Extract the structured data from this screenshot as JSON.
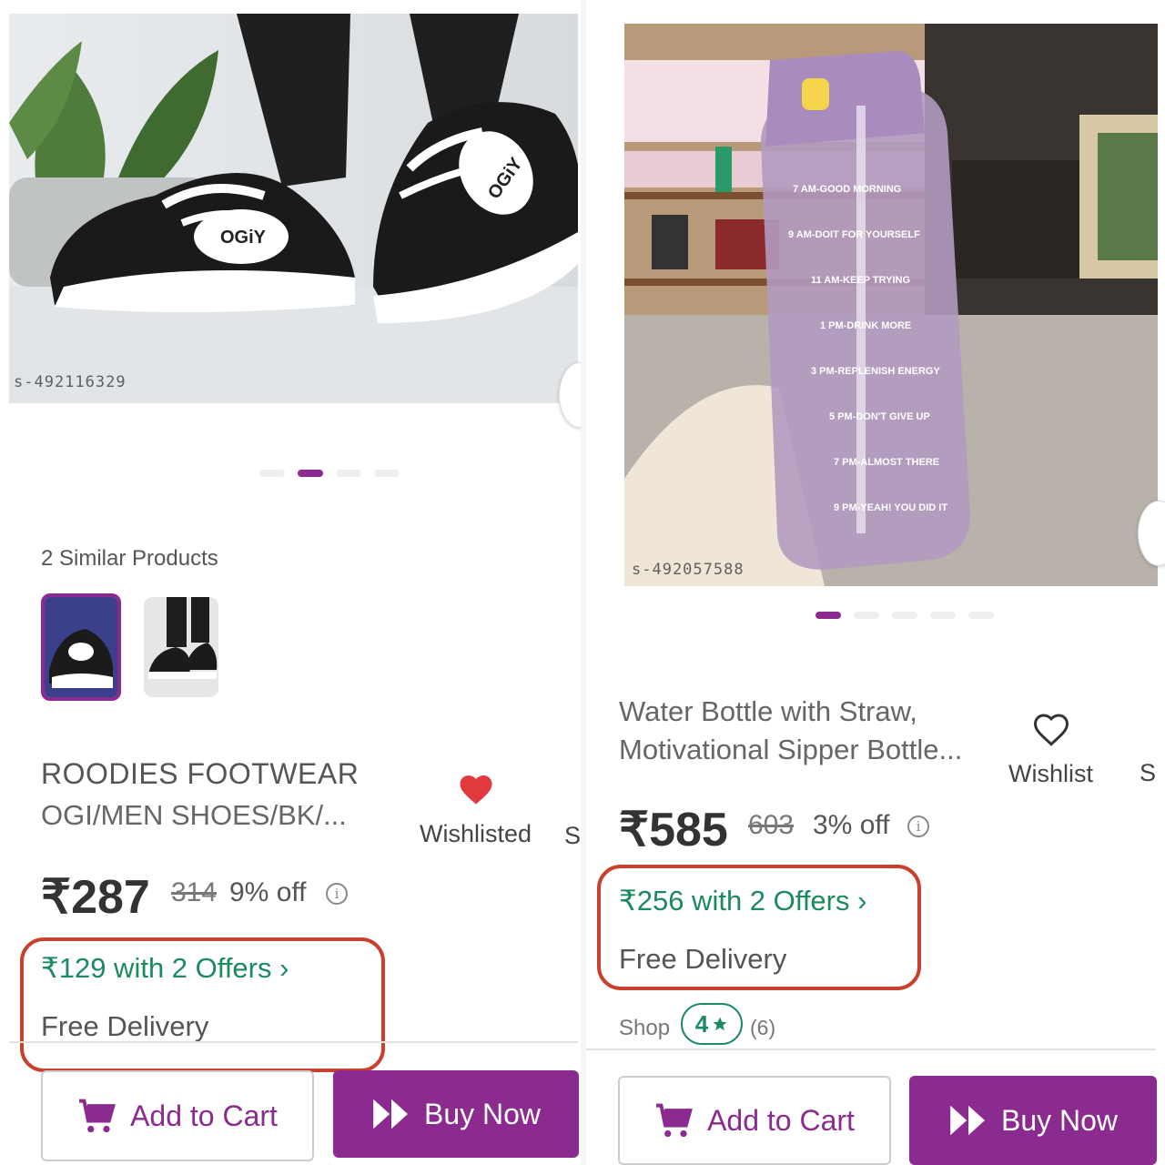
{
  "left_product": {
    "image_sku": "s-492116329",
    "similar_title": "2 Similar Products",
    "brand": "ROODIES FOOTWEAR",
    "title": "OGI/MEN SHOES/BK/...",
    "wishlist_label": "Wishlisted",
    "wishlist_icon": "heart-filled-icon",
    "side_peek": "S",
    "price": "₹287",
    "mrp": "314",
    "discount": "9% off",
    "offer": "₹129 with 2 Offers ›",
    "delivery": "Free Delivery",
    "add_to_cart": "Add to Cart",
    "buy_now": "Buy Now"
  },
  "right_product": {
    "image_sku": "s-492057588",
    "title_line1": "Water Bottle with Straw,",
    "title_line2": "Motivational Sipper Bottle...",
    "wishlist_label": "Wishlist",
    "wishlist_icon": "heart-outline-icon",
    "side_peek": "S",
    "price": "₹585",
    "mrp": "603",
    "discount": "3% off",
    "offer": "₹256 with 2 Offers ›",
    "delivery": "Free Delivery",
    "shop_label": "Shop",
    "rating": "4",
    "rating_count": "(6)",
    "add_to_cart": "Add to Cart",
    "buy_now": "Buy Now"
  },
  "colors": {
    "accent": "#8b2a8f",
    "offer_green": "#1b8a5e",
    "highlight_red": "#c9402c",
    "heart_red": "#e03a3e"
  }
}
